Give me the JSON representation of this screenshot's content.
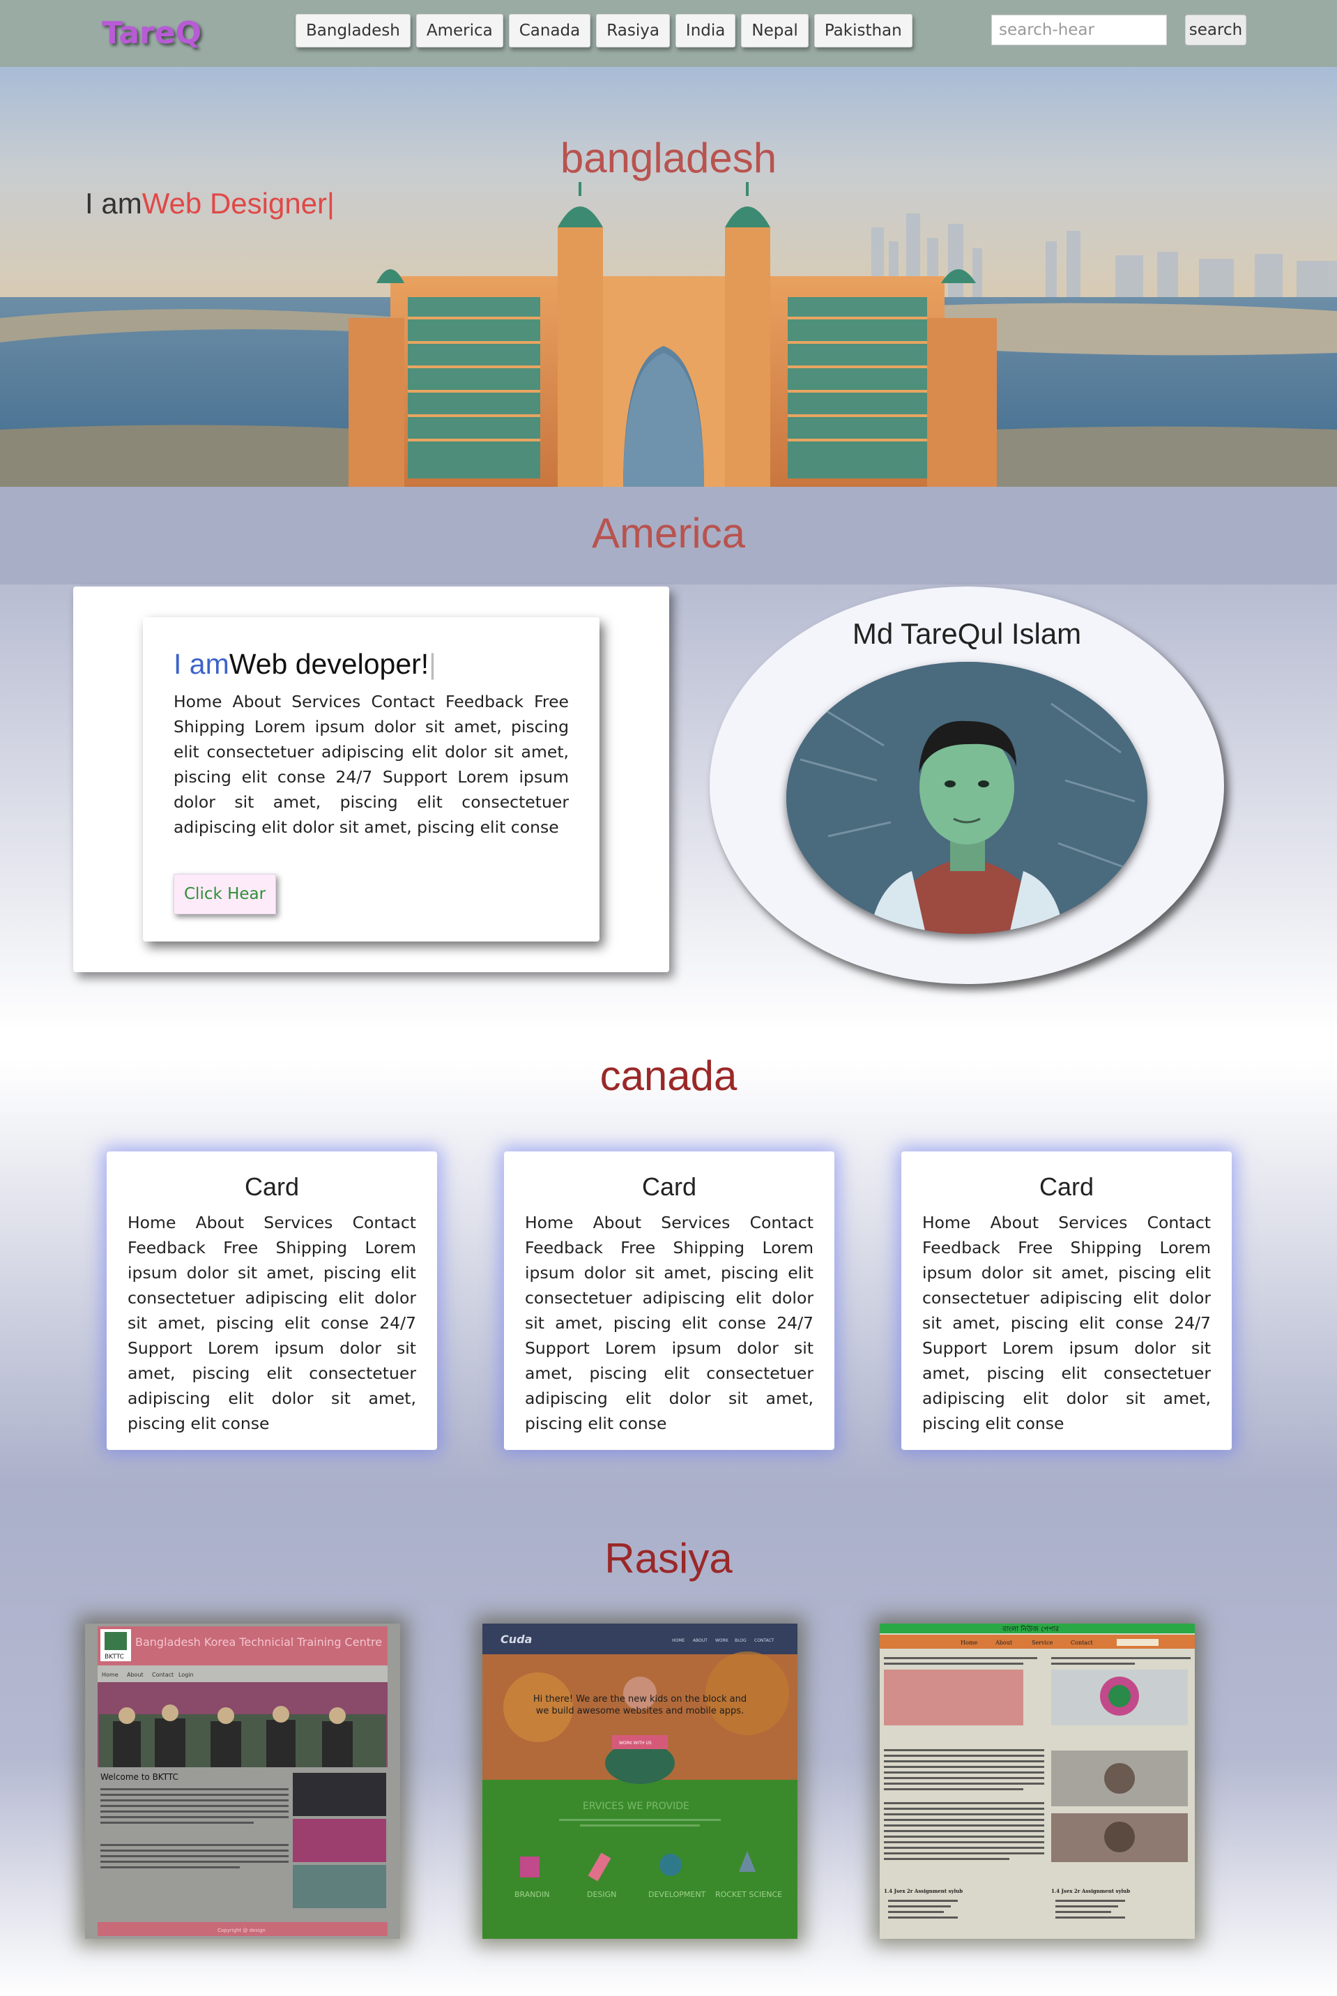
{
  "navbar": {
    "logo": "TareQ",
    "items": [
      "Bangladesh",
      "America",
      "Canada",
      "Rasiya",
      "India",
      "Nepal",
      "Pakisthan"
    ],
    "search_placeholder": "search-hear",
    "search_button": "search"
  },
  "hero": {
    "title": "bangladesh",
    "typed_prefix": "I am",
    "typed_word": "Web Designer|"
  },
  "america": {
    "title": "America",
    "heading_prefix": "I am",
    "heading_word": "Web developer!",
    "heading_cursor": "|",
    "text": "Home About Services Contact Feedback Free Shipping Lorem ipsum dolor sit amet, piscing elit consectetuer adipiscing elit dolor sit amet, piscing elit conse 24/7 Support Lorem ipsum dolor sit amet, piscing elit consectetuer adipiscing elit dolor sit amet, piscing elit conse",
    "button": "Click Hear",
    "profile_name": "Md TareQul Islam"
  },
  "canada": {
    "title": "canada",
    "cards": [
      {
        "title": "Card",
        "text": "Home About Services Contact Feedback Free Shipping Lorem ipsum dolor sit amet, piscing elit consectetuer adipiscing elit dolor sit amet, piscing elit conse 24/7 Support Lorem ipsum dolor sit amet, piscing elit consectetuer adipiscing elit dolor sit amet, piscing elit conse"
      },
      {
        "title": "Card",
        "text": "Home About Services Contact Feedback Free Shipping Lorem ipsum dolor sit amet, piscing elit consectetuer adipiscing elit dolor sit amet, piscing elit conse 24/7 Support Lorem ipsum dolor sit amet, piscing elit consectetuer adipiscing elit dolor sit amet, piscing elit conse"
      },
      {
        "title": "Card",
        "text": "Home About Services Contact Feedback Free Shipping Lorem ipsum dolor sit amet, piscing elit consectetuer adipiscing elit dolor sit amet, piscing elit conse 24/7 Support Lorem ipsum dolor sit amet, piscing elit consectetuer adipiscing elit dolor sit amet, piscing elit conse"
      }
    ]
  },
  "rasiya": {
    "title": "Rasiya",
    "shots": [
      {
        "brand": "BKTTC",
        "header": "Bangladesh Korea Technicial Training Centre",
        "nav": [
          "Home",
          "About",
          "Contact",
          "Login"
        ],
        "welcome": "Welcome to BKTTC",
        "footer": "Copyright @ design"
      },
      {
        "brand": "Cuda",
        "nav": [
          "HOME",
          "ABOUT",
          "WORK",
          "BLOG",
          "CONTACT"
        ],
        "hero_text": "Hi there! We are the new kids on the block and we build awesome websites and mobile apps.",
        "hero_button": "WORK WITH US",
        "services_title": "ERVICES WE PROVIDE",
        "services": [
          "BRANDIN",
          "DESIGN",
          "DEVELOPMENT",
          "ROCKET SCIENCE"
        ]
      },
      {
        "header": "বাংলা নিউজ পেপার",
        "nav": [
          "Home",
          "About",
          "Service",
          "Contact"
        ],
        "section": "1.4 Jsex 2r Assignment sylub"
      }
    ]
  },
  "colors": {
    "navbar_bg": "#9aaba4",
    "logo": "#b85bd6",
    "section_title_red": "#b8534f",
    "typed_accent": "#e04848",
    "developer_blue": "#3d63c8",
    "click_button_text": "#2f8f36",
    "card_glow": "#6a76f0"
  }
}
